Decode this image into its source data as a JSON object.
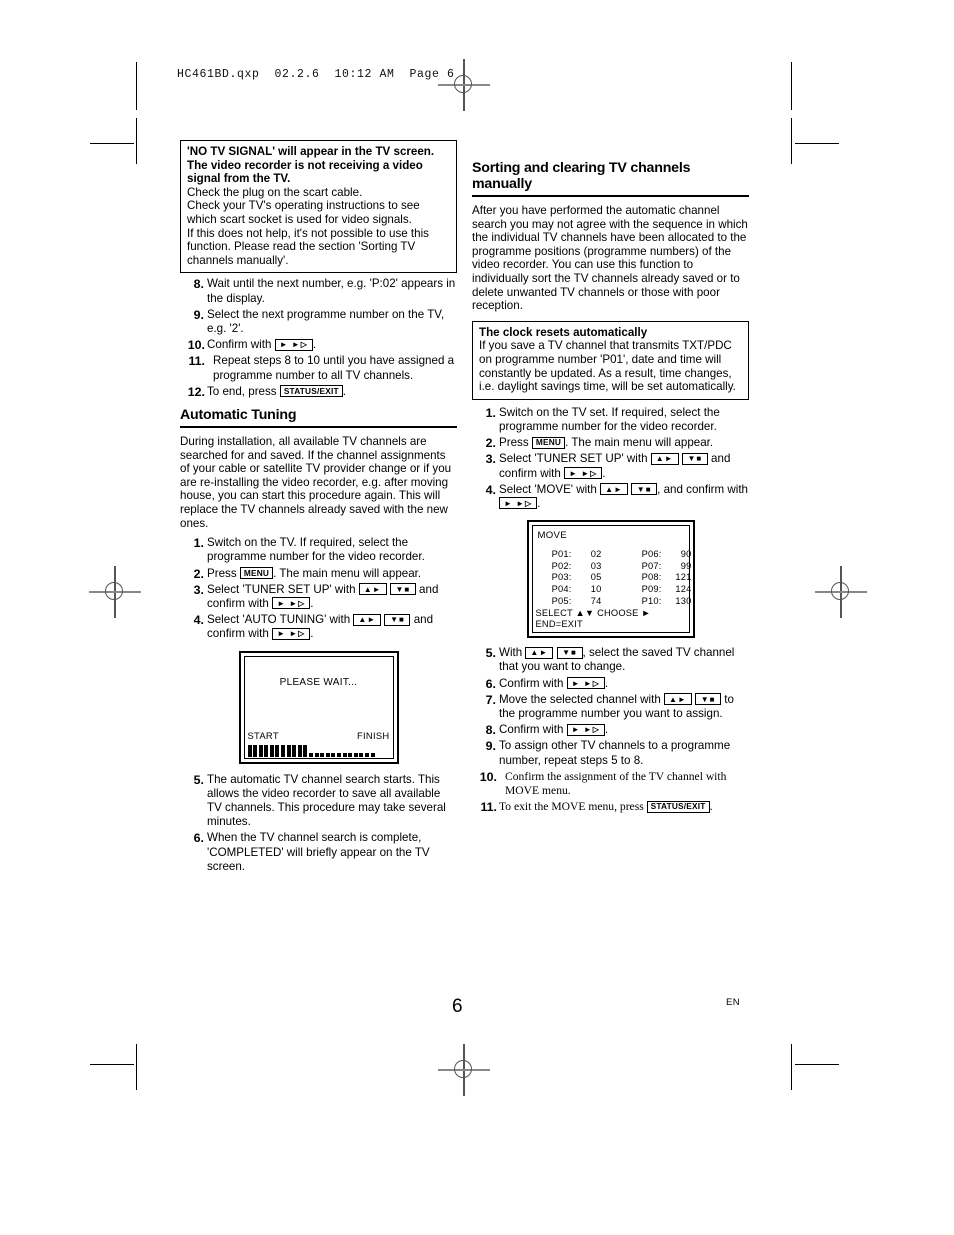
{
  "file_header": "HC461BD.qxp  02.2.6  10:12 AM  Page 6",
  "page_number": "6",
  "language_label": "EN",
  "left_column": {
    "notice_box": {
      "bold_lines": [
        "'NO TV SIGNAL' will appear in the TV screen.",
        "The video recorder is not receiving a video",
        "signal from the TV."
      ],
      "body_lines": [
        "Check the plug on the scart cable.",
        "Check your TV's operating instructions to see",
        "which scart socket is used for video signals.",
        "If this does not help, it's not possible to use this",
        "function. Please read the section 'Sorting TV",
        "channels manually'."
      ]
    },
    "steps_continued": [
      {
        "num": "8.",
        "text": "Wait until the next number, e.g. 'P:02' appears in the display."
      },
      {
        "num": "9.",
        "text": "Select the next programme number on the TV, e.g. '2'."
      },
      {
        "num": "10.",
        "text": "Confirm with ",
        "key_after": "play-fwd",
        "tail": "."
      },
      {
        "num": "11.",
        "text": "Repeat steps 8 to 10 until you have assigned a programme number to all TV channels.",
        "indent": true
      },
      {
        "num": "12.",
        "text": "To end, press ",
        "key_after": "STATUS/EXIT",
        "tail": "."
      }
    ],
    "section_heading": "Automatic Tuning",
    "intro_paragraph": "During installation, all available TV channels are searched for and saved. If the channel assignments of your cable or satellite TV provider change or if you are re-installing the video recorder, e.g. after moving house, you can start this procedure again. This will replace the TV channels already saved with the new ones.",
    "steps": [
      {
        "num": "1.",
        "text": "Switch on the TV. If required, select the programme number for the video recorder."
      },
      {
        "num": "2.",
        "text": "Press ",
        "key": "MENU",
        "tail": ". The main menu will appear."
      },
      {
        "num": "3.",
        "text": "Select 'TUNER SET UP' with ",
        "keys": [
          "up-right",
          "down-stop"
        ],
        "mid": " and confirm with ",
        "key2": "play-fwd",
        "tail": "."
      },
      {
        "num": "4.",
        "text": "Select 'AUTO TUNING' with ",
        "keys": [
          "up-right",
          "down-stop"
        ],
        "mid": " and confirm with ",
        "key2": "play-fwd",
        "tail": "."
      }
    ],
    "tv_screen": {
      "message": "PLEASE WAIT...",
      "start_label": "START",
      "finish_label": "FINISH",
      "bars_filled": 11,
      "bars_empty": 12
    },
    "steps_after": [
      {
        "num": "5.",
        "text": "The automatic TV channel search starts. This allows the video recorder to save all available TV channels. This procedure may take several minutes."
      },
      {
        "num": "6.",
        "text": "When the TV channel search is complete, 'COMPLETED' will briefly appear on the TV screen."
      }
    ]
  },
  "right_column": {
    "section_heading": "Sorting and clearing TV channels manually",
    "intro_paragraph": "After you have performed the automatic channel search you may not agree with the sequence in which the individual TV channels have been allocated to the programme positions (programme numbers) of the video recorder. You can use this function to individually sort the TV channels already saved or to delete unwanted TV channels or those with poor reception.",
    "clock_box": {
      "title": "The clock resets automatically",
      "body": "If you save a TV channel that transmits TXT/PDC on programme number 'P01', date and time will constantly be updated. As a result, time changes, i.e. daylight savings time, will be set automatically."
    },
    "steps": [
      {
        "num": "1.",
        "text": "Switch on the TV set. If required, select the programme number for the video recorder."
      },
      {
        "num": "2.",
        "text": "Press ",
        "key": "MENU",
        "tail": ". The main menu will appear."
      },
      {
        "num": "3.",
        "text": "Select 'TUNER SET UP' with ",
        "keys": [
          "up-right",
          "down-stop"
        ],
        "mid": " and confirm with ",
        "key2": "play-fwd",
        "tail": "."
      },
      {
        "num": "4.",
        "text": "Select 'MOVE' with ",
        "keys": [
          "up-right",
          "down-stop"
        ],
        "mid": ", and confirm with ",
        "key2": "play-fwd",
        "tail": "."
      }
    ],
    "move_menu": {
      "title": "MOVE",
      "entries_left": [
        {
          "label": "P01:",
          "value": "02"
        },
        {
          "label": "P02:",
          "value": "03"
        },
        {
          "label": "P03:",
          "value": "05"
        },
        {
          "label": "P04:",
          "value": "10"
        },
        {
          "label": "P05:",
          "value": "74"
        }
      ],
      "entries_right": [
        {
          "label": "P06:",
          "value": "90"
        },
        {
          "label": "P07:",
          "value": "99"
        },
        {
          "label": "P08:",
          "value": "121"
        },
        {
          "label": "P09:",
          "value": "124"
        },
        {
          "label": "P10:",
          "value": "130"
        }
      ],
      "footer_line1": "SELECT ▲▼  CHOOSE ►",
      "footer_line2": "END=EXIT"
    },
    "steps_after": [
      {
        "num": "5.",
        "text": "With ",
        "keys": [
          "up-right",
          "down-stop"
        ],
        "mid": ", select the saved TV channel that you want to change."
      },
      {
        "num": "6.",
        "text": "Confirm with ",
        "key2": "play-fwd",
        "tail": "."
      },
      {
        "num": "7.",
        "text": "Move the selected channel with ",
        "keys": [
          "up-right",
          "down-stop"
        ],
        "mid": " to the programme number you want to assign."
      },
      {
        "num": "8.",
        "text": "Confirm with ",
        "key2": "play-fwd",
        "tail": "."
      },
      {
        "num": "9.",
        "text": "To assign other TV channels to a programme number, repeat steps 5 to 8."
      },
      {
        "num": "10.",
        "text": "Confirm the assignment of the TV channel with MOVE menu.",
        "indent": true
      },
      {
        "num": "11.",
        "text": "To exit the MOVE menu, press ",
        "key_after": "STATUS/EXIT",
        "tail": "."
      }
    ]
  },
  "keycaps": {
    "menu": "MENU",
    "status_exit": "STATUS/EXIT",
    "up_right": "▲►",
    "down_stop": "▼■",
    "play_fwd": "► ►▷"
  }
}
